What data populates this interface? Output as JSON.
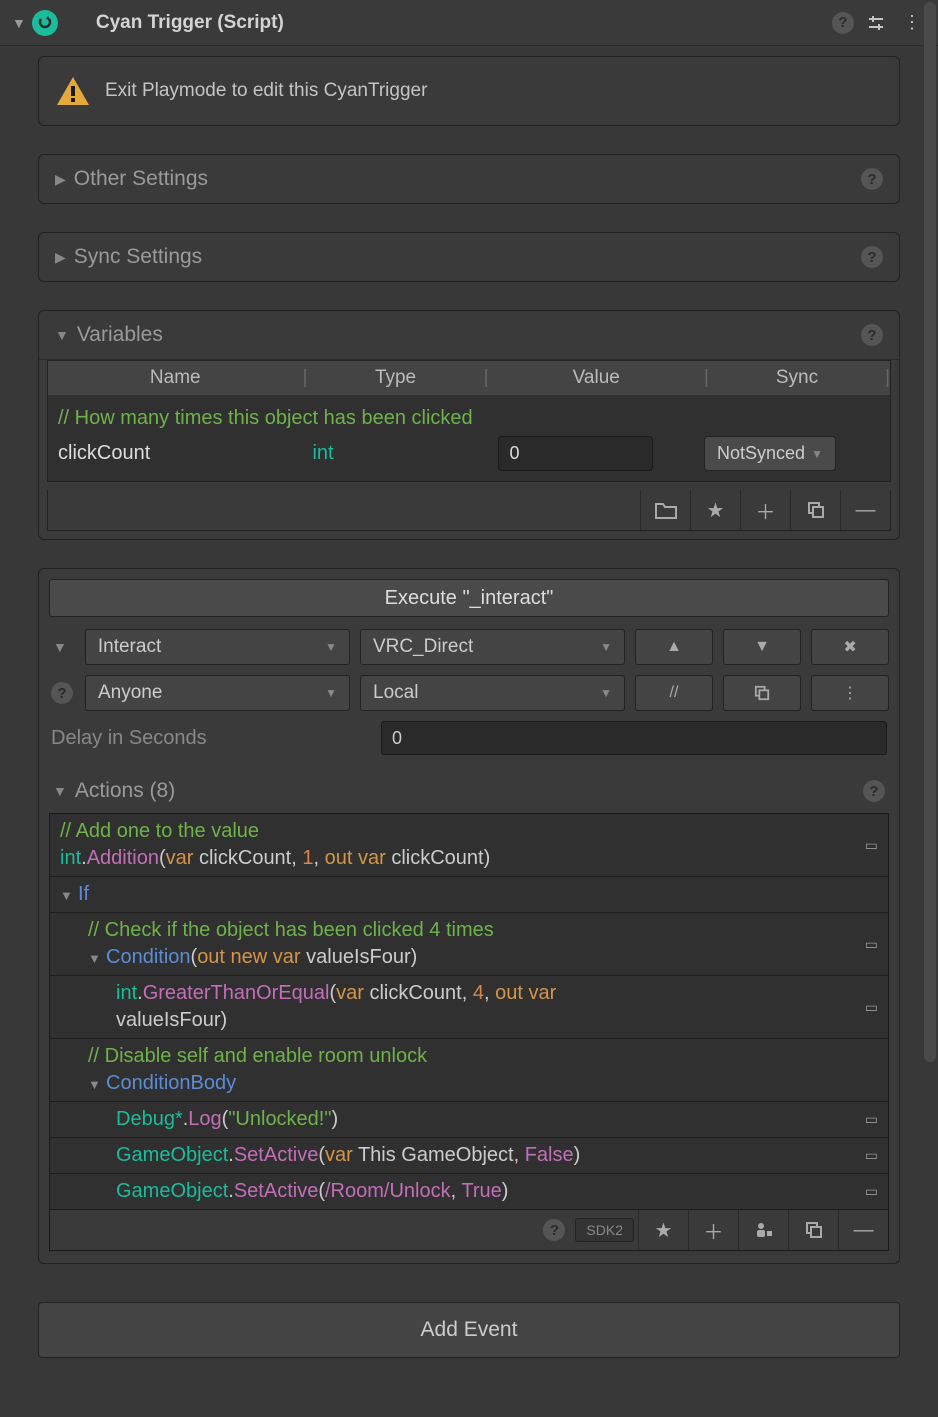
{
  "header": {
    "title": "Cyan Trigger (Script)"
  },
  "warning": {
    "text": "Exit Playmode to edit this CyanTrigger"
  },
  "sections": {
    "other": {
      "title": "Other Settings"
    },
    "sync": {
      "title": "Sync Settings"
    },
    "variables": {
      "title": "Variables",
      "columns": {
        "name": "Name",
        "type": "Type",
        "value": "Value",
        "sync": "Sync"
      },
      "comment": "// How many times this object has been clicked",
      "row": {
        "name": "clickCount",
        "type": "int",
        "value": "0",
        "sync": "NotSynced"
      }
    }
  },
  "event": {
    "execute_label": "Execute \"_interact\"",
    "trigger_type": "Interact",
    "broadcast": "VRC_Direct",
    "who": "Anyone",
    "scope": "Local",
    "delay_label": "Delay in Seconds",
    "delay_value": "0",
    "slash": "//"
  },
  "actions": {
    "title": "Actions (8)",
    "c1": "// Add one to the value",
    "a1": {
      "type": "int",
      "method": "Addition",
      "var1": "clickCount",
      "num": "1",
      "out_var": "clickCount"
    },
    "if_kw": "If",
    "c2": "// Check if the object has been clicked 4 times",
    "cond_kw": "Condition",
    "cond_out": "valueIsFour",
    "a2": {
      "type": "int",
      "method": "GreaterThanOrEqual",
      "var1": "clickCount",
      "num": "4",
      "out_var": "valueIsFour"
    },
    "c3": "// Disable self and enable room unlock",
    "condbody_kw": "ConditionBody",
    "a3": {
      "type": "Debug*",
      "method": "Log",
      "str": "\"Unlocked!\""
    },
    "a4": {
      "type": "GameObject",
      "method": "SetActive",
      "arg1": "This GameObject",
      "bool": "False"
    },
    "a5": {
      "type": "GameObject",
      "method": "SetActive",
      "path": "/Room/Unlock",
      "bool": "True"
    },
    "sdk_label": "SDK2"
  },
  "add_event": "Add Event"
}
